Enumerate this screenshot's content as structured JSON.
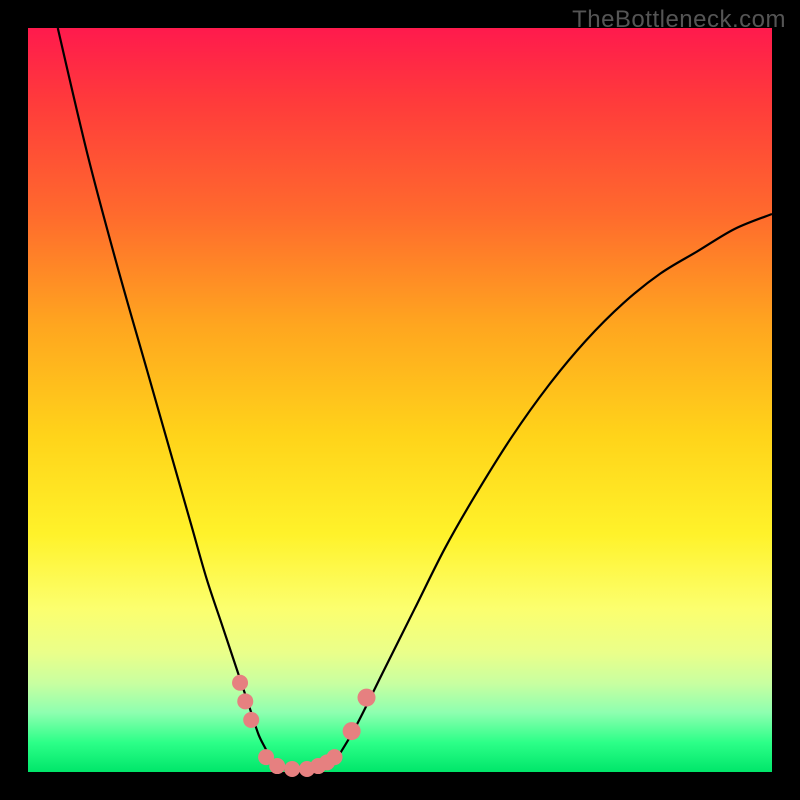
{
  "watermark": "TheBottleneck.com",
  "colors": {
    "gradient_top": "#ff1a4d",
    "gradient_bottom": "#00e66a",
    "curve": "#000000",
    "dots": "#e68080",
    "frame": "#000000"
  },
  "chart_data": {
    "type": "line",
    "title": "",
    "xlabel": "",
    "ylabel": "",
    "x_range": [
      0,
      100
    ],
    "y_range": [
      0,
      100
    ],
    "series": [
      {
        "name": "left_branch",
        "x": [
          4,
          8,
          12,
          16,
          20,
          22,
          24,
          26,
          27,
          28,
          29,
          30,
          31,
          32,
          33
        ],
        "y": [
          100,
          83,
          68,
          54,
          40,
          33,
          26,
          20,
          17,
          14,
          11,
          8,
          5,
          3,
          1
        ]
      },
      {
        "name": "valley_floor",
        "x": [
          33,
          34,
          35,
          36,
          37,
          38,
          39,
          40,
          41
        ],
        "y": [
          1,
          0.5,
          0.3,
          0.2,
          0.2,
          0.3,
          0.5,
          0.8,
          1
        ]
      },
      {
        "name": "right_branch",
        "x": [
          41,
          44,
          48,
          52,
          56,
          60,
          65,
          70,
          75,
          80,
          85,
          90,
          95,
          100
        ],
        "y": [
          1,
          6,
          14,
          22,
          30,
          37,
          45,
          52,
          58,
          63,
          67,
          70,
          73,
          75
        ]
      }
    ],
    "markers": [
      {
        "series": "left_branch_dots",
        "x": 28.5,
        "y": 12
      },
      {
        "series": "left_branch_dots",
        "x": 29.2,
        "y": 9.5
      },
      {
        "series": "left_branch_dots",
        "x": 30.0,
        "y": 7
      },
      {
        "series": "valley_dots",
        "x": 32.0,
        "y": 2
      },
      {
        "series": "valley_dots",
        "x": 33.5,
        "y": 0.8
      },
      {
        "series": "valley_dots",
        "x": 35.5,
        "y": 0.4
      },
      {
        "series": "valley_dots",
        "x": 37.5,
        "y": 0.4
      },
      {
        "series": "valley_dots",
        "x": 39.0,
        "y": 0.8
      },
      {
        "series": "valley_dots",
        "x": 40.2,
        "y": 1.3
      },
      {
        "series": "valley_dots",
        "x": 41.2,
        "y": 2.0
      },
      {
        "series": "right_branch_dots",
        "x": 43.5,
        "y": 5.5
      },
      {
        "series": "right_branch_dots",
        "x": 45.5,
        "y": 10
      }
    ]
  }
}
